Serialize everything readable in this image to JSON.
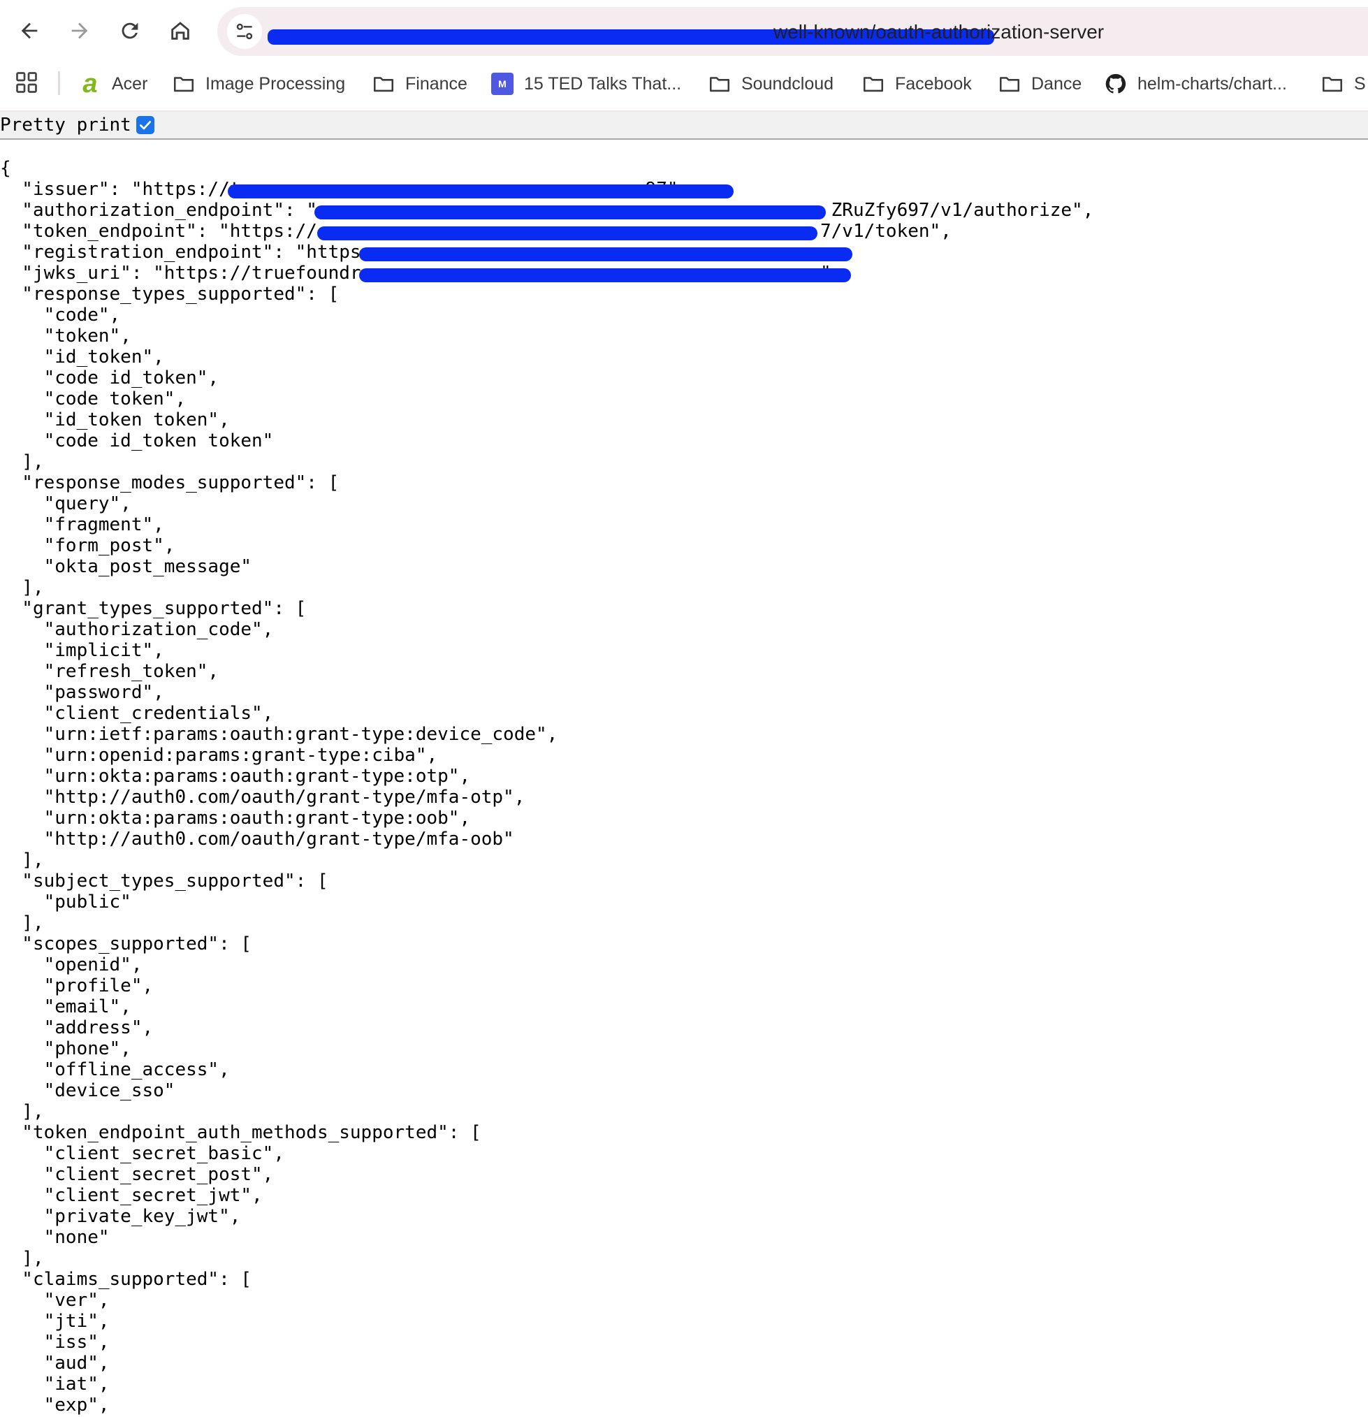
{
  "browser": {
    "url_visible": "well-known/oauth-authorization-server",
    "icons": {
      "back": "back-arrow-icon",
      "forward": "forward-arrow-icon",
      "reload": "reload-icon",
      "home": "home-icon",
      "site_info": "tune-icon"
    }
  },
  "bookmarks": {
    "items": [
      {
        "label": "Acer",
        "icon": "acer-logo"
      },
      {
        "label": "Image Processing",
        "icon": "folder-icon"
      },
      {
        "label": "Finance",
        "icon": "folder-icon"
      },
      {
        "label": "15 TED Talks That...",
        "icon": "ted-icon"
      },
      {
        "label": "Soundcloud",
        "icon": "folder-icon"
      },
      {
        "label": "Facebook",
        "icon": "folder-icon"
      },
      {
        "label": "Dance",
        "icon": "folder-icon"
      },
      {
        "label": "helm-charts/chart...",
        "icon": "github-icon"
      },
      {
        "label": "S",
        "icon": "folder-icon"
      }
    ]
  },
  "pretty_print": {
    "label": "Pretty print",
    "checked": true
  },
  "json_lines": [
    "{",
    "  \"issuer\": \"https://t                                     97\",",
    "  \"authorization_endpoint\": \"                                               ZRuZfy697/v1/authorize\",",
    "  \"token_endpoint\": \"https://                                              7/v1/token\",",
    "  \"registration_endpoint\": \"https",
    "  \"jwks_uri\": \"https://truefoundr                                         s\",",
    "  \"response_types_supported\": [",
    "    \"code\",",
    "    \"token\",",
    "    \"id_token\",",
    "    \"code id_token\",",
    "    \"code token\",",
    "    \"id_token token\",",
    "    \"code id_token token\"",
    "  ],",
    "  \"response_modes_supported\": [",
    "    \"query\",",
    "    \"fragment\",",
    "    \"form_post\",",
    "    \"okta_post_message\"",
    "  ],",
    "  \"grant_types_supported\": [",
    "    \"authorization_code\",",
    "    \"implicit\",",
    "    \"refresh_token\",",
    "    \"password\",",
    "    \"client_credentials\",",
    "    \"urn:ietf:params:oauth:grant-type:device_code\",",
    "    \"urn:openid:params:grant-type:ciba\",",
    "    \"urn:okta:params:oauth:grant-type:otp\",",
    "    \"http://auth0.com/oauth/grant-type/mfa-otp\",",
    "    \"urn:okta:params:oauth:grant-type:oob\",",
    "    \"http://auth0.com/oauth/grant-type/mfa-oob\"",
    "  ],",
    "  \"subject_types_supported\": [",
    "    \"public\"",
    "  ],",
    "  \"scopes_supported\": [",
    "    \"openid\",",
    "    \"profile\",",
    "    \"email\",",
    "    \"address\",",
    "    \"phone\",",
    "    \"offline_access\",",
    "    \"device_sso\"",
    "  ],",
    "  \"token_endpoint_auth_methods_supported\": [",
    "    \"client_secret_basic\",",
    "    \"client_secret_post\",",
    "    \"client_secret_jwt\",",
    "    \"private_key_jwt\",",
    "    \"none\"",
    "  ],",
    "  \"claims_supported\": [",
    "    \"ver\",",
    "    \"jti\",",
    "    \"iss\",",
    "    \"aud\",",
    "    \"iat\",",
    "    \"exp\","
  ],
  "colors": {
    "redaction": "#0a2cf2",
    "checkbox": "#1a73e8",
    "omnibox": "#f5ecef"
  }
}
